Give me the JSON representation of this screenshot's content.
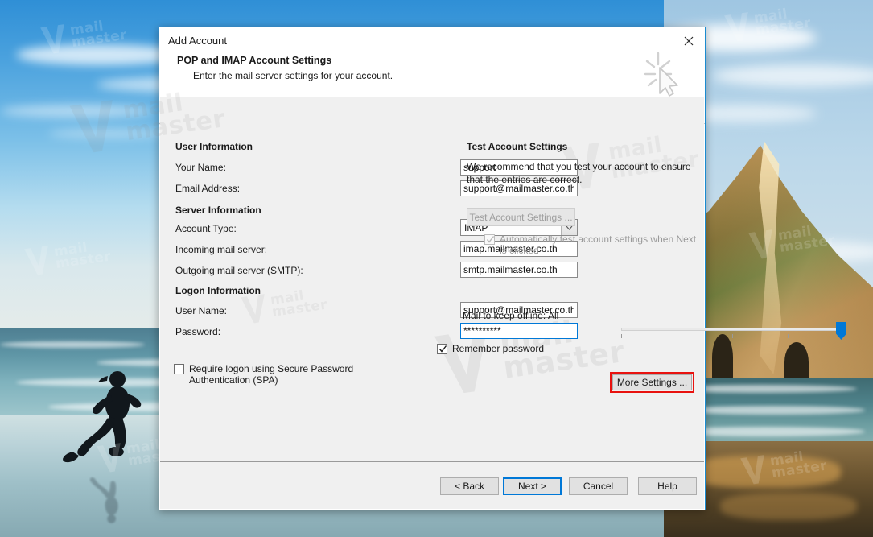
{
  "window": {
    "title": "Add Account",
    "close_icon": "close-icon",
    "cursor_icon": "click-cursor-icon"
  },
  "header": {
    "title": "POP and IMAP Account Settings",
    "subtitle": "Enter the mail server settings for your account."
  },
  "sections": {
    "user_information": "User Information",
    "server_information": "Server Information",
    "logon_information": "Logon Information",
    "test_account_settings": "Test Account Settings"
  },
  "fields": {
    "your_name": {
      "label": "Your Name:",
      "value": "support"
    },
    "email_address": {
      "label": "Email Address:",
      "value": "support@mailmaster.co.th"
    },
    "account_type": {
      "label": "Account Type:",
      "value": "IMAP",
      "dropdown_icon": "chevron-down-icon"
    },
    "incoming_mail_server": {
      "label": "Incoming mail server:",
      "value": "imap.mailmaster.co.th"
    },
    "outgoing_mail_server": {
      "label": "Outgoing mail server (SMTP):",
      "value": "smtp.mailmaster.co.th"
    },
    "user_name": {
      "label": "User Name:",
      "value": "support@mailmaster.co.th"
    },
    "password": {
      "label": "Password:",
      "value": "**********"
    }
  },
  "checkboxes": {
    "remember_password": {
      "label": "Remember password",
      "checked": true,
      "enabled": true
    },
    "require_spa": {
      "label": "Require logon using Secure Password Authentication (SPA)",
      "checked": false,
      "enabled": true
    },
    "auto_test": {
      "label": "Automatically test account settings when Next is clicked",
      "checked": true,
      "enabled": false
    }
  },
  "test_panel": {
    "description": "We recommend that you test your account to ensure that the entries are correct.",
    "test_button": "Test Account Settings ...",
    "test_button_enabled": false
  },
  "offline_slider": {
    "label": "Mail to keep offline:",
    "value": "All",
    "position_percent": 100,
    "tick_count": 5
  },
  "more_settings": {
    "label": "More Settings ...",
    "highlight_color": "#e8120f"
  },
  "footer_buttons": [
    {
      "label": "< Back",
      "name": "back-button",
      "focused": false
    },
    {
      "label": "Next >",
      "name": "next-button",
      "focused": true
    },
    {
      "label": "Cancel",
      "name": "cancel-button",
      "focused": false
    },
    {
      "label": "Help",
      "name": "help-button",
      "focused": false
    }
  ],
  "watermark": {
    "text_line1": "mail",
    "text_line2": "master"
  },
  "colors": {
    "accent": "#0078d7",
    "dialog_border": "#1b8bd0",
    "highlight": "#e8120f"
  }
}
